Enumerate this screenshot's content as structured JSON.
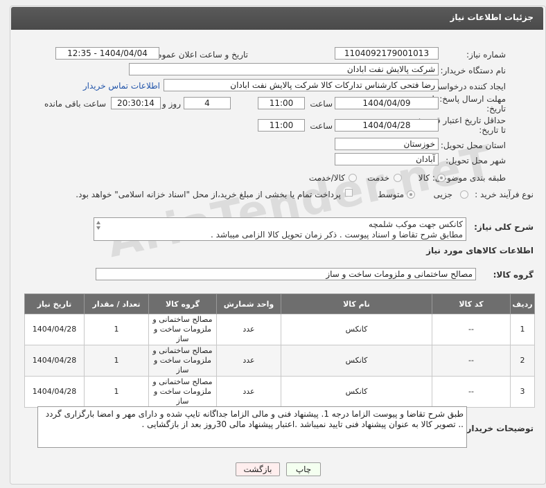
{
  "header": {
    "title": "جزئیات اطلاعات نیاز"
  },
  "watermark": "AriaTender.neT",
  "fields": {
    "need_number_label": "شماره نیاز:",
    "need_number": "1104092179001013",
    "announce_label": "تاریخ و ساعت اعلان عمومی:",
    "announce_value": "1404/04/04 - 12:35",
    "buyer_org_label": "نام دستگاه خریدار:",
    "buyer_org": "شرکت پالایش نفت ابادان",
    "creator_label": "ایجاد کننده درخواست:",
    "creator": "رضا فتحی کارشناس تدارکات کالا  شرکت پالایش نفت ابادان",
    "contact_link": "اطلاعات تماس خریدار",
    "deadline_label_1": "مهلت ارسال پاسخ: تا",
    "deadline_label_2": "تاریخ:",
    "deadline_date": "1404/04/09",
    "hour_label": "ساعت",
    "deadline_time": "11:00",
    "days_value": "4",
    "days_label": "روز و",
    "remaining_time": "20:30:14",
    "remaining_label": "ساعت باقی مانده",
    "validity_label_1": "حداقل تاریخ اعتبار قیمت:",
    "validity_label_2": "تا تاریخ:",
    "validity_date": "1404/04/28",
    "validity_time": "11:00",
    "province_label": "استان محل تحویل:",
    "province": "خوزستان",
    "city_label": "شهر محل تحویل:",
    "city": "آبادان",
    "category_label": "طبقه بندی موضوعی:",
    "category_options": [
      "کالا",
      "خدمت",
      "کالا/خدمت"
    ],
    "process_label": "نوع فرآیند خرید :",
    "process_options": [
      "جزیی",
      "متوسط"
    ],
    "payment_note": "پرداخت تمام یا بخشی از مبلغ خرید،از محل \"اسناد خزانه اسلامی\" خواهد بود."
  },
  "description": {
    "label": "شرح کلی نیاز:",
    "line1": "کانکس جهت موکب شلمچه",
    "line2": "مطابق شرح تقاضا و اسناد پیوست . ذکر زمان تحویل کالا الزامی میباشد ."
  },
  "goods_section": {
    "title": "اطلاعات کالاهای مورد نیاز",
    "group_label": "گروه کالا:",
    "group_value": "مصالح ساختمانی و ملزومات ساخت و ساز"
  },
  "table": {
    "headers": [
      "ردیف",
      "کد کالا",
      "نام کالا",
      "واحد شمارش",
      "گروه کالا",
      "تعداد / مقدار",
      "تاریخ نیاز"
    ],
    "rows": [
      [
        "1",
        "--",
        "کانکس",
        "عدد",
        "مصالح ساختمانی و ملزومات ساخت و ساز",
        "1",
        "1404/04/28"
      ],
      [
        "2",
        "--",
        "کانکس",
        "عدد",
        "مصالح ساختمانی و ملزومات ساخت و ساز",
        "1",
        "1404/04/28"
      ],
      [
        "3",
        "--",
        "کانکس",
        "عدد",
        "مصالح ساختمانی و ملزومات ساخت و ساز",
        "1",
        "1404/04/28"
      ]
    ]
  },
  "buyer_notes": {
    "label": "توضیحات خریدار:",
    "text": "طبق شرح تقاضا و پیوست الزاما درجه 1. پیشنهاد فنی و مالی الزاما جداگانه تایپ شده و دارای مهر و امضا بارگزاری گردد .. تصویر کالا به عنوان پیشنهاد فنی تایید نمیباشد .اعتبار پیشنهاد مالی 30روز بعد از بازگشایی ."
  },
  "buttons": {
    "print": "چاپ",
    "back": "بازگشت"
  }
}
